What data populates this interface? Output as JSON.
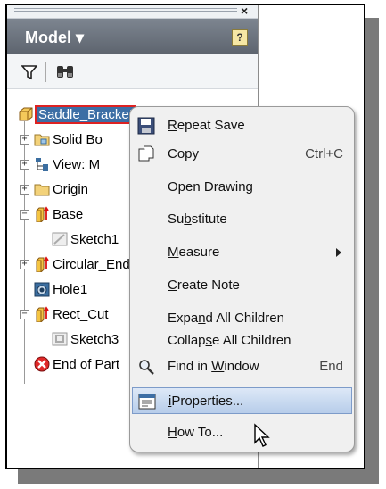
{
  "panel": {
    "title": "Model",
    "title_arrow": "▾",
    "help": "?",
    "close": "×"
  },
  "tree": {
    "root": "Saddle_Bracket",
    "nodes": [
      {
        "label": "Solid Bo",
        "expander": "+"
      },
      {
        "label": "View: M",
        "expander": "+"
      },
      {
        "label": "Origin",
        "expander": "+"
      },
      {
        "label": "Base",
        "expander": "−"
      },
      {
        "label": "Sketch1",
        "expander": ""
      },
      {
        "label": "Circular_End",
        "expander": "+"
      },
      {
        "label": "Hole1",
        "expander": ""
      },
      {
        "label": "Rect_Cut",
        "expander": "−"
      },
      {
        "label": "Sketch3",
        "expander": ""
      },
      {
        "label": "End of Part",
        "expander": ""
      }
    ]
  },
  "menu": {
    "items": [
      {
        "pre": "",
        "u": "R",
        "post": "epeat Save",
        "shortcut": ""
      },
      {
        "pre": "",
        "u": "",
        "post": "Copy",
        "shortcut": "Ctrl+C"
      },
      {
        "pre": "",
        "u": "",
        "post": "Open Drawing",
        "shortcut": ""
      },
      {
        "pre": "Su",
        "u": "b",
        "post": "stitute",
        "shortcut": ""
      },
      {
        "pre": "",
        "u": "M",
        "post": "easure",
        "shortcut": ""
      },
      {
        "pre": "",
        "u": "C",
        "post": "reate Note",
        "shortcut": ""
      },
      {
        "pre": "Expa",
        "u": "n",
        "post": "d All Children",
        "shortcut": ""
      },
      {
        "pre": "Collap",
        "u": "s",
        "post": "e All Children",
        "shortcut": ""
      },
      {
        "pre": "Find in ",
        "u": "W",
        "post": "indow",
        "shortcut": "End"
      },
      {
        "pre": "",
        "u": "i",
        "post": "Properties...",
        "shortcut": ""
      },
      {
        "pre": "",
        "u": "H",
        "post": "ow To...",
        "shortcut": ""
      }
    ]
  },
  "colors": {
    "header": "#6b727c",
    "highlight": "#c9daf1",
    "selection": "#3c6ea5"
  }
}
